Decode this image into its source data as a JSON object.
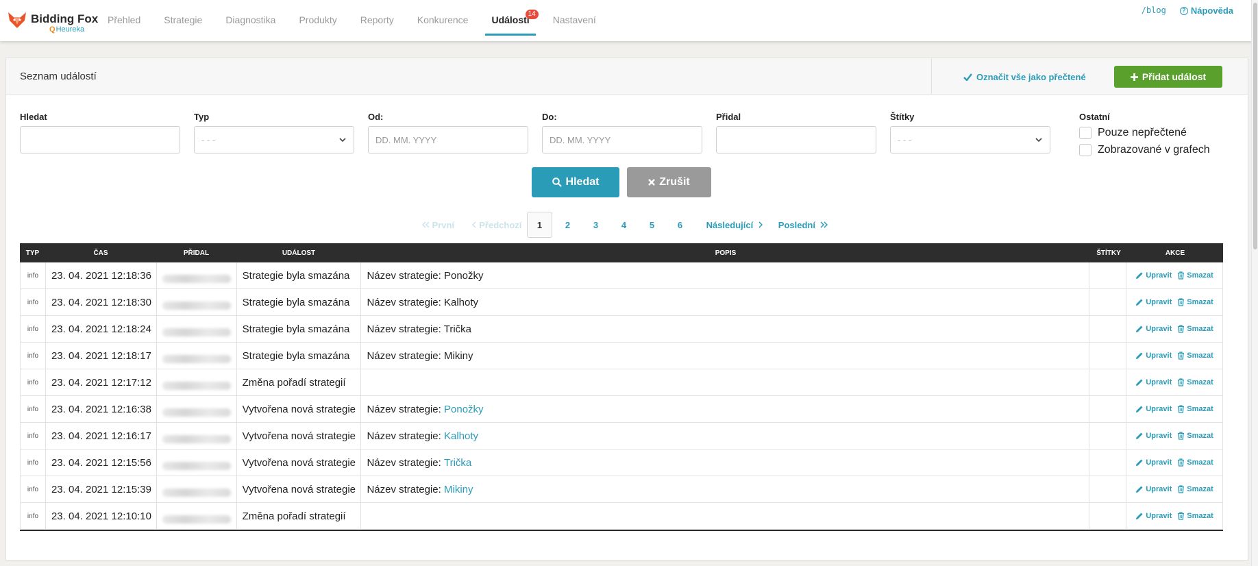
{
  "header": {
    "brand": "Bidding Fox",
    "sub_brand": "Heureka",
    "nav": [
      {
        "label": "Přehled"
      },
      {
        "label": "Strategie"
      },
      {
        "label": "Diagnostika"
      },
      {
        "label": "Produkty"
      },
      {
        "label": "Reporty"
      },
      {
        "label": "Konkurence"
      },
      {
        "label": "Události",
        "badge": "14",
        "active": true
      },
      {
        "label": "Nastavení"
      }
    ],
    "blog_link": "/blog",
    "help_link": "Nápověda"
  },
  "panel": {
    "title": "Seznam událostí",
    "mark_all_read": "Označit vše jako přečtené",
    "add_event": "Přidat událost"
  },
  "filters": {
    "search_label": "Hledat",
    "search_value": "",
    "type_label": "Typ",
    "type_value": "- - -",
    "from_label": "Od:",
    "from_placeholder": "DD. MM. YYYY",
    "to_label": "Do:",
    "to_placeholder": "DD. MM. YYYY",
    "added_by_label": "Přidal",
    "added_by_value": "",
    "tags_label": "Štítky",
    "tags_value": "- - -",
    "other_label": "Ostatní",
    "unread_only": "Pouze nepřečtené",
    "shown_in_charts": "Zobrazované v grafech",
    "search_button": "Hledat",
    "cancel_button": "Zrušit"
  },
  "pagination": {
    "first": "První",
    "prev": "Předchozí",
    "pages": [
      "1",
      "2",
      "3",
      "4",
      "5",
      "6"
    ],
    "current": "1",
    "next": "Následující",
    "last": "Poslední"
  },
  "table": {
    "columns": [
      "Typ",
      "Čas",
      "Přidal",
      "Událost",
      "Popis",
      "Štítky",
      "Akce"
    ],
    "edit_label": "Upravit",
    "delete_label": "Smazat",
    "rows": [
      {
        "type": "info",
        "time": "23. 04. 2021 12:18:36",
        "event": "Strategie byla smazána",
        "desc_prefix": "Název strategie: Ponožky",
        "desc_link": ""
      },
      {
        "type": "info",
        "time": "23. 04. 2021 12:18:30",
        "event": "Strategie byla smazána",
        "desc_prefix": "Název strategie: Kalhoty",
        "desc_link": ""
      },
      {
        "type": "info",
        "time": "23. 04. 2021 12:18:24",
        "event": "Strategie byla smazána",
        "desc_prefix": "Název strategie: Trička",
        "desc_link": ""
      },
      {
        "type": "info",
        "time": "23. 04. 2021 12:18:17",
        "event": "Strategie byla smazána",
        "desc_prefix": "Název strategie: Mikiny",
        "desc_link": ""
      },
      {
        "type": "info",
        "time": "23. 04. 2021 12:17:12",
        "event": "Změna pořadí strategií",
        "desc_prefix": "",
        "desc_link": ""
      },
      {
        "type": "info",
        "time": "23. 04. 2021 12:16:38",
        "event": "Vytvořena nová strategie",
        "desc_prefix": "Název strategie: ",
        "desc_link": "Ponožky"
      },
      {
        "type": "info",
        "time": "23. 04. 2021 12:16:17",
        "event": "Vytvořena nová strategie",
        "desc_prefix": "Název strategie: ",
        "desc_link": "Kalhoty"
      },
      {
        "type": "info",
        "time": "23. 04. 2021 12:15:56",
        "event": "Vytvořena nová strategie",
        "desc_prefix": "Název strategie: ",
        "desc_link": "Trička"
      },
      {
        "type": "info",
        "time": "23. 04. 2021 12:15:39",
        "event": "Vytvořena nová strategie",
        "desc_prefix": "Název strategie: ",
        "desc_link": "Mikiny"
      },
      {
        "type": "info",
        "time": "23. 04. 2021 12:10:10",
        "event": "Změna pořadí strategií",
        "desc_prefix": "",
        "desc_link": ""
      }
    ]
  },
  "colors": {
    "accent": "#2a9cb8",
    "add_button": "#5aa02c",
    "badge": "#e84b3c",
    "table_header": "#2d2d2d"
  },
  "icons": [
    "fox-logo-icon",
    "help-circle-icon",
    "check-icon",
    "plus-icon",
    "chevron-down-icon",
    "search-icon",
    "close-icon",
    "double-chevron-left-icon",
    "chevron-left-icon",
    "chevron-right-icon",
    "double-chevron-right-icon",
    "pencil-icon",
    "trash-icon"
  ]
}
